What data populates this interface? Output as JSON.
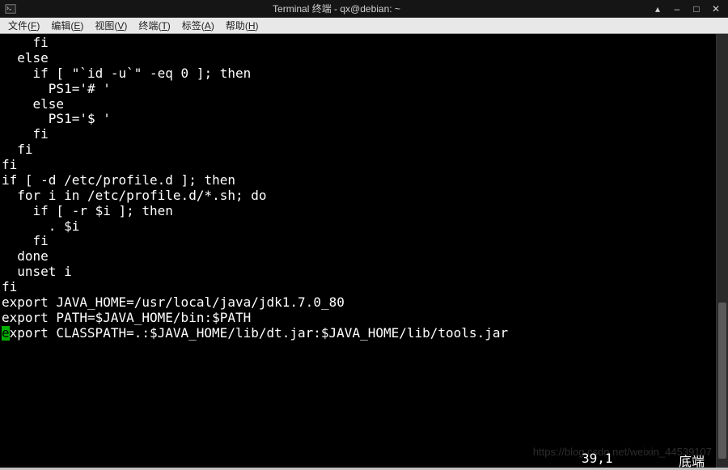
{
  "window": {
    "title": "Terminal 终端 - qx@debian: ~"
  },
  "menubar": {
    "items": [
      {
        "label": "文件",
        "mnemonic": "F"
      },
      {
        "label": "编辑",
        "mnemonic": "E"
      },
      {
        "label": "视图",
        "mnemonic": "V"
      },
      {
        "label": "终端",
        "mnemonic": "T"
      },
      {
        "label": "标签",
        "mnemonic": "A"
      },
      {
        "label": "帮助",
        "mnemonic": "H"
      }
    ]
  },
  "terminal": {
    "lines": [
      "    fi",
      "  else",
      "    if [ \"`id -u`\" -eq 0 ]; then",
      "      PS1='# '",
      "    else",
      "      PS1='$ '",
      "    fi",
      "  fi",
      "fi",
      "",
      "if [ -d /etc/profile.d ]; then",
      "  for i in /etc/profile.d/*.sh; do",
      "    if [ -r $i ]; then",
      "      . $i",
      "    fi",
      "  done",
      "  unset i",
      "fi",
      "",
      "",
      "export JAVA_HOME=/usr/local/java/jdk1.7.0_80",
      "export PATH=$JAVA_HOME/bin:$PATH"
    ],
    "cursor_line_text": "xport CLASSPATH=.:$JAVA_HOME/lib/dt.jar:$JAVA_HOME/lib/tools.jar",
    "status": {
      "position": "39,1",
      "location": "底端"
    }
  },
  "scrollbar": {
    "thumb_top_pct": 62,
    "thumb_height_pct": 36
  },
  "watermark": "https://blog.csdn.net/weixin_44539107"
}
